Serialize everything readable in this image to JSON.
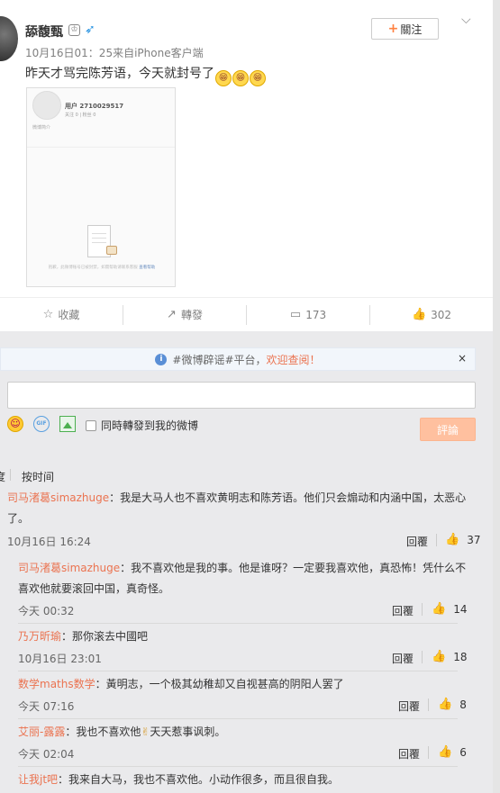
{
  "post": {
    "username": "舔馥甄",
    "crown_badge": "♔",
    "plane_badge": "➶",
    "meta": "10月16日01：25来自iPhone客户端",
    "follow_label": "關注",
    "follow_plus": "+",
    "chevron": "⌵",
    "text": "昨天才骂完陈芳语，今天就封号了",
    "emojis": [
      "😁",
      "😁",
      "😁"
    ],
    "image": {
      "user": "用户 2710029517",
      "stats": "关注 0  |  粉丝 0",
      "sub": "微博简介",
      "note": "抱歉，此微博账号已被封禁，如需帮助请联系客服",
      "note_link": "查看帮助"
    }
  },
  "actions": [
    {
      "icon": "☆",
      "label": "收藏",
      "name": "collect"
    },
    {
      "icon": "↗",
      "label": "轉發",
      "name": "repost"
    },
    {
      "icon": "▭",
      "label": "173",
      "name": "comment"
    },
    {
      "icon": "👍",
      "label": "302",
      "name": "like"
    }
  ],
  "rumor_bar": {
    "icon": "i",
    "prefix": "#微博辟谣#平台，",
    "link": "欢迎查阅！",
    "close": "×"
  },
  "composer": {
    "gif_label": "GIF",
    "repost_label": "同時轉發到我的微博",
    "submit_label": "評論"
  },
  "sort": {
    "left": "度",
    "right": "按时间"
  },
  "comments": [
    {
      "user": "司马渚葛simazhuge",
      "text": "：我是大马人也不喜欢黄明志和陈芳语。他们只会煽动和内涵中国，太恶心",
      "text2": "了。",
      "date": "10月16日 16:24",
      "reply": "回覆",
      "likes": "37"
    }
  ],
  "replies": [
    {
      "user": "司马渚葛simazhuge",
      "text": "：我不喜欢他是我的事。他是谁呀？一定要我喜欢他，真恐怖！凭什么不",
      "text2": "喜欢他就要滚回中国，真奇怪。",
      "date": "今天 00:32",
      "reply": "回覆",
      "likes": "14"
    },
    {
      "user": "乃万昕瑜",
      "text": "：那你滚去中國吧",
      "date": "10月16日 23:01",
      "reply": "回覆",
      "likes": "18"
    },
    {
      "user": "数学maths数学",
      "text": "：黃明志，一个极其幼稚却又自视甚高的阴阳人罢了",
      "date": "今天 07:16",
      "reply": "回覆",
      "likes": "8"
    },
    {
      "user": "艾丽-露露",
      "text": "：我也不喜欢他",
      "emoji": "✌",
      "text_after": "天天惹事讽刺。",
      "date": "今天 02:04",
      "reply": "回覆",
      "likes": "6"
    },
    {
      "user": "让我jt吧",
      "text": "：我来自大马，我也不喜欢他。小动作很多，而且很自我。"
    }
  ],
  "icons": {
    "thumb": "👍",
    "smile": "☺"
  }
}
